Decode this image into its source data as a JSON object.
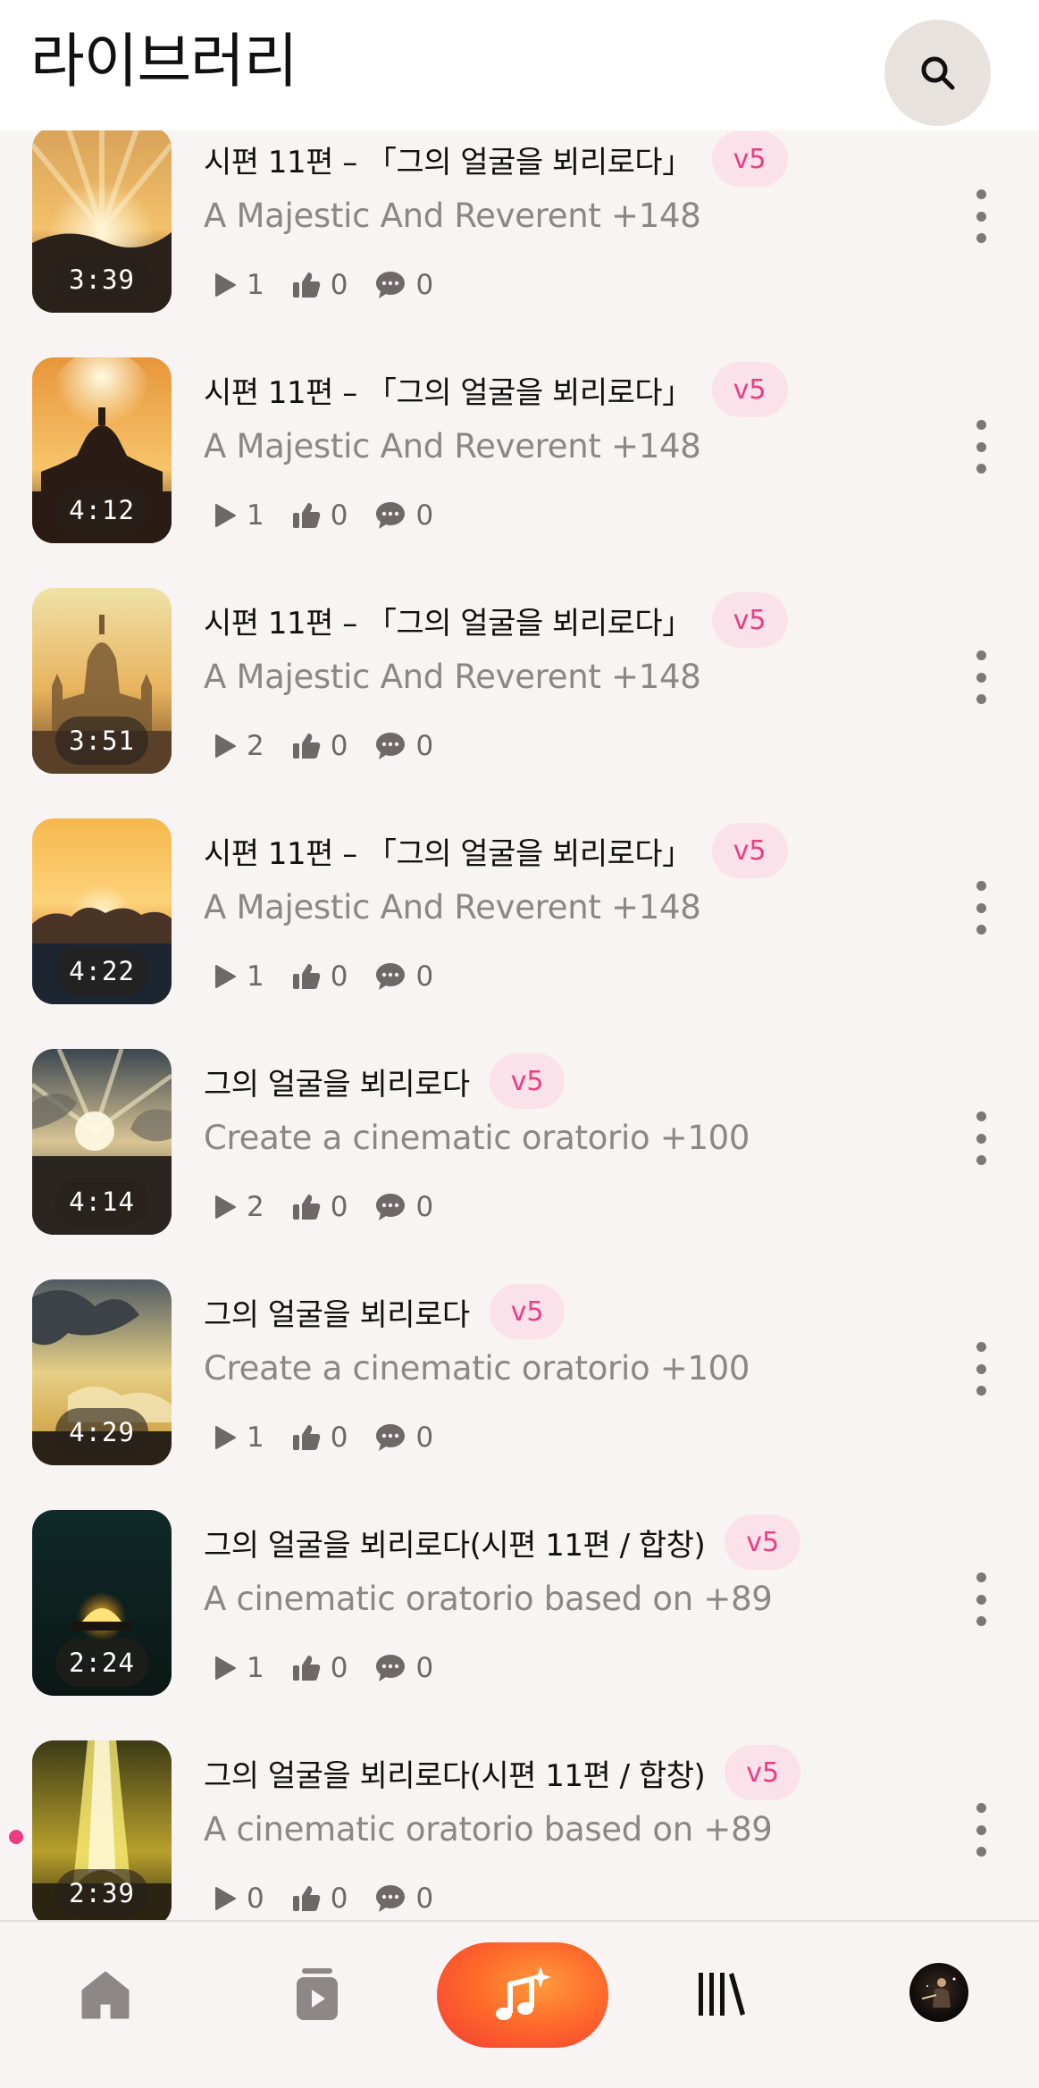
{
  "header": {
    "title": "라이브러리"
  },
  "tracks": [
    {
      "title": "시편 11편 – 「그의 얼굴을 뵈리로다」",
      "version": "v5",
      "subtitle": "A Majestic And Reverent +148",
      "duration": "3:39",
      "plays": "1",
      "likes": "0",
      "comments": "0",
      "thumb": "rays-hills",
      "active": false
    },
    {
      "title": "시편 11편 – 「그의 얼굴을 뵈리로다」",
      "version": "v5",
      "subtitle": "A Majestic And Reverent +148",
      "duration": "4:12",
      "plays": "1",
      "likes": "0",
      "comments": "0",
      "thumb": "temple-sun",
      "active": false
    },
    {
      "title": "시편 11편 – 「그의 얼굴을 뵈리로다」",
      "version": "v5",
      "subtitle": "A Majestic And Reverent +148",
      "duration": "3:51",
      "plays": "2",
      "likes": "0",
      "comments": "0",
      "thumb": "temple-gold",
      "active": false
    },
    {
      "title": "시편 11편 – 「그의 얼굴을 뵈리로다」",
      "version": "v5",
      "subtitle": "A Majestic And Reverent +148",
      "duration": "4:22",
      "plays": "1",
      "likes": "0",
      "comments": "0",
      "thumb": "sunset-clouds",
      "active": false
    },
    {
      "title": "그의 얼굴을 뵈리로다",
      "version": "v5",
      "subtitle": "Create a cinematic oratorio +100",
      "duration": "4:14",
      "plays": "2",
      "likes": "0",
      "comments": "0",
      "thumb": "cloud-rays",
      "active": false
    },
    {
      "title": "그의 얼굴을 뵈리로다",
      "version": "v5",
      "subtitle": "Create a cinematic oratorio +100",
      "duration": "4:29",
      "plays": "1",
      "likes": "0",
      "comments": "0",
      "thumb": "cloud-sky",
      "active": false
    },
    {
      "title": "그의 얼굴을 뵈리로다(시편 11편 / 합창)",
      "version": "v5",
      "subtitle": "A cinematic oratorio based on +89",
      "duration": "2:24",
      "plays": "1",
      "likes": "0",
      "comments": "0",
      "thumb": "dark-glow",
      "active": false
    },
    {
      "title": "그의 얼굴을 뵈리로다(시편 11편 / 합창)",
      "version": "v5",
      "subtitle": "A cinematic oratorio based on +89",
      "duration": "2:39",
      "plays": "0",
      "likes": "0",
      "comments": "0",
      "thumb": "light-beam",
      "active": true
    }
  ],
  "nav": {
    "items": [
      {
        "name": "home-icon"
      },
      {
        "name": "feed-icon"
      },
      {
        "name": "create-music-icon"
      },
      {
        "name": "library-icon"
      },
      {
        "name": "profile-avatar"
      }
    ]
  },
  "colors": {
    "accent": "#ec3d82",
    "badge_bg": "#fbe1ea",
    "create_gradient": [
      "#ff9a3c",
      "#f23a36"
    ]
  }
}
